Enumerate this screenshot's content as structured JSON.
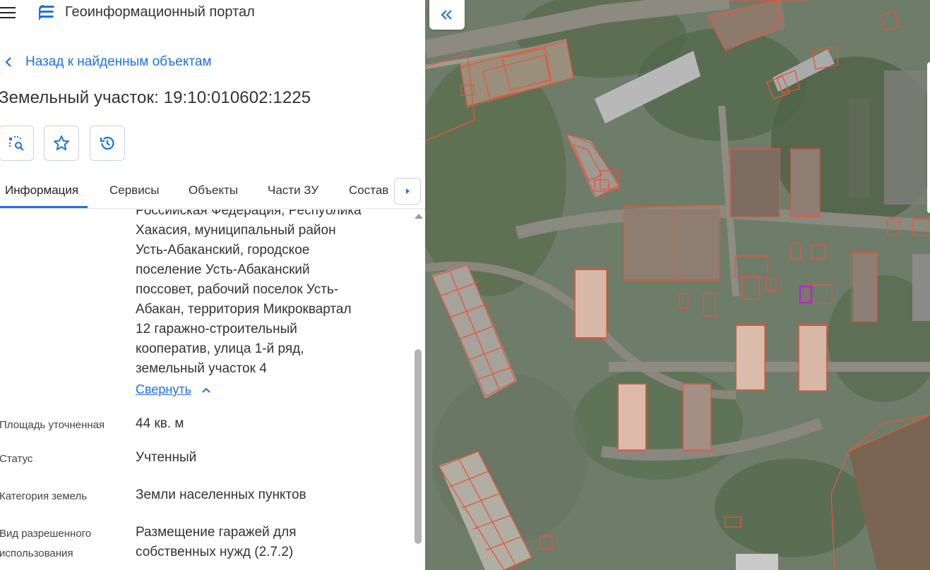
{
  "header": {
    "app_title": "Геоинформационный портал",
    "menu_icon": "hamburger-menu-icon",
    "logo_icon": "portal-logo-icon"
  },
  "navigation": {
    "back_label": "Назад к найденным объектам"
  },
  "object": {
    "title": "Земельный участок: 19:10:010602:1225"
  },
  "actions": [
    {
      "name": "select-on-map-button",
      "icon": "area-search-icon"
    },
    {
      "name": "favorite-button",
      "icon": "star-icon"
    },
    {
      "name": "history-button",
      "icon": "history-icon"
    }
  ],
  "tabs": [
    {
      "label": "Информация",
      "active": true
    },
    {
      "label": "Сервисы",
      "active": false
    },
    {
      "label": "Объекты",
      "active": false
    },
    {
      "label": "Части ЗУ",
      "active": false
    },
    {
      "label": "Состав",
      "active": false
    }
  ],
  "details": {
    "address_lines": [
      "Российская Федерация, Республика",
      "Хакасия, муниципальный район",
      "Усть-Абаканский, городское",
      "поселение Усть-Абаканский",
      "поссовет, рабочий поселок Усть-",
      "Абакан, территория Микроквартал",
      "12 гаражно-строительный",
      "кооператив, улица 1-й ряд,",
      "земельный участок 4"
    ],
    "collapse_label": "Свернуть",
    "properties": [
      {
        "label": "Площадь уточненная",
        "value": "44 кв. м"
      },
      {
        "label": "Статус",
        "value": "Учтенный"
      },
      {
        "label": "Категория земель",
        "value": "Земли населенных пунктов"
      },
      {
        "label_lines": [
          "Вид разрешенного",
          "использования"
        ],
        "value_lines": [
          "Размещение гаражей для",
          "собственных нужд (2.7.2)"
        ]
      }
    ]
  },
  "colors": {
    "accent": "#1a73e8",
    "parcel_outline": "#e8553a",
    "selected_parcel": "#c020d8"
  }
}
